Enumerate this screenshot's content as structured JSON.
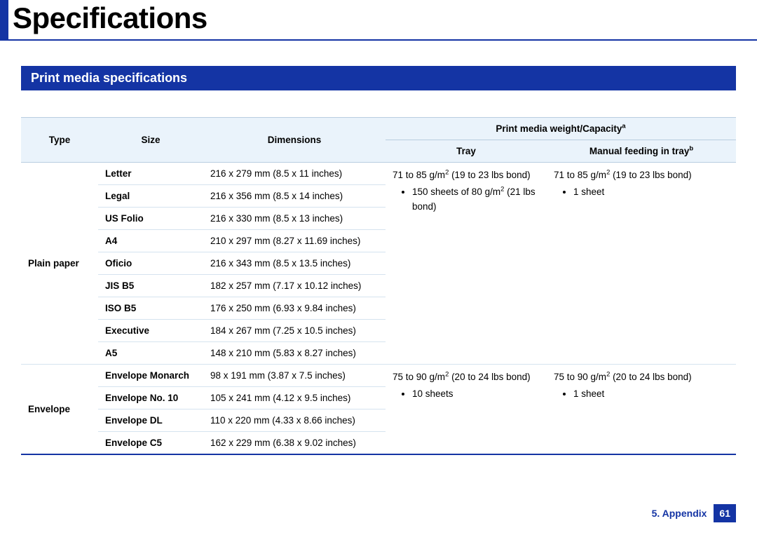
{
  "page_title": "Specifications",
  "section_title": "Print media specifications",
  "headers": {
    "type": "Type",
    "size": "Size",
    "dimensions": "Dimensions",
    "capacity_group": "Print media weight/Capacity",
    "capacity_group_sup": "a",
    "tray": "Tray",
    "manual": "Manual feeding in tray",
    "manual_sup": "b"
  },
  "groups": [
    {
      "type": "Plain paper",
      "rows": [
        {
          "size": "Letter",
          "dim": "216 x 279 mm (8.5 x 11 inches)"
        },
        {
          "size": "Legal",
          "dim": "216 x 356 mm (8.5 x 14 inches)"
        },
        {
          "size": "US Folio",
          "dim": "216 x 330 mm (8.5 x 13 inches)"
        },
        {
          "size": "A4",
          "dim": "210 x 297 mm (8.27 x 11.69 inches)"
        },
        {
          "size": "Oficio",
          "dim": "216 x 343 mm (8.5 x 13.5 inches)"
        },
        {
          "size": "JIS B5",
          "dim": "182 x 257 mm (7.17 x 10.12 inches)"
        },
        {
          "size": "ISO B5",
          "dim": "176 x 250 mm (6.93 x 9.84 inches)"
        },
        {
          "size": "Executive",
          "dim": "184 x 267 mm (7.25 x 10.5 inches)"
        },
        {
          "size": "A5",
          "dim": "148 x 210 mm (5.83 x 8.27 inches)"
        }
      ],
      "tray": {
        "text_pre": "71 to 85 g/m",
        "sup": "2",
        "text_post": " (19 to 23 lbs bond)",
        "bullet_pre": "150 sheets of 80 g/m",
        "bullet_sup": "2",
        "bullet_post": " (21 lbs bond)"
      },
      "manual": {
        "text_pre": "71 to 85 g/m",
        "sup": "2",
        "text_post": " (19 to 23 lbs bond)",
        "bullet": "1 sheet"
      }
    },
    {
      "type": "Envelope",
      "rows": [
        {
          "size": "Envelope Monarch",
          "dim": "98 x 191 mm (3.87 x 7.5 inches)"
        },
        {
          "size": "Envelope No. 10",
          "dim": "105 x 241 mm (4.12 x 9.5 inches)"
        },
        {
          "size": "Envelope DL",
          "dim": "110 x 220 mm (4.33 x 8.66 inches)"
        },
        {
          "size": "Envelope C5",
          "dim": "162 x 229 mm (6.38 x 9.02 inches)"
        }
      ],
      "tray": {
        "text_pre": "75 to 90 g/m",
        "sup": "2",
        "text_post": " (20 to 24 lbs bond)",
        "bullet": "10 sheets"
      },
      "manual": {
        "text_pre": "75 to 90 g/m",
        "sup": "2",
        "text_post": " (20 to 24 lbs bond)",
        "bullet": "1 sheet"
      }
    }
  ],
  "footer": {
    "section": "5. Appendix",
    "page": "61"
  }
}
